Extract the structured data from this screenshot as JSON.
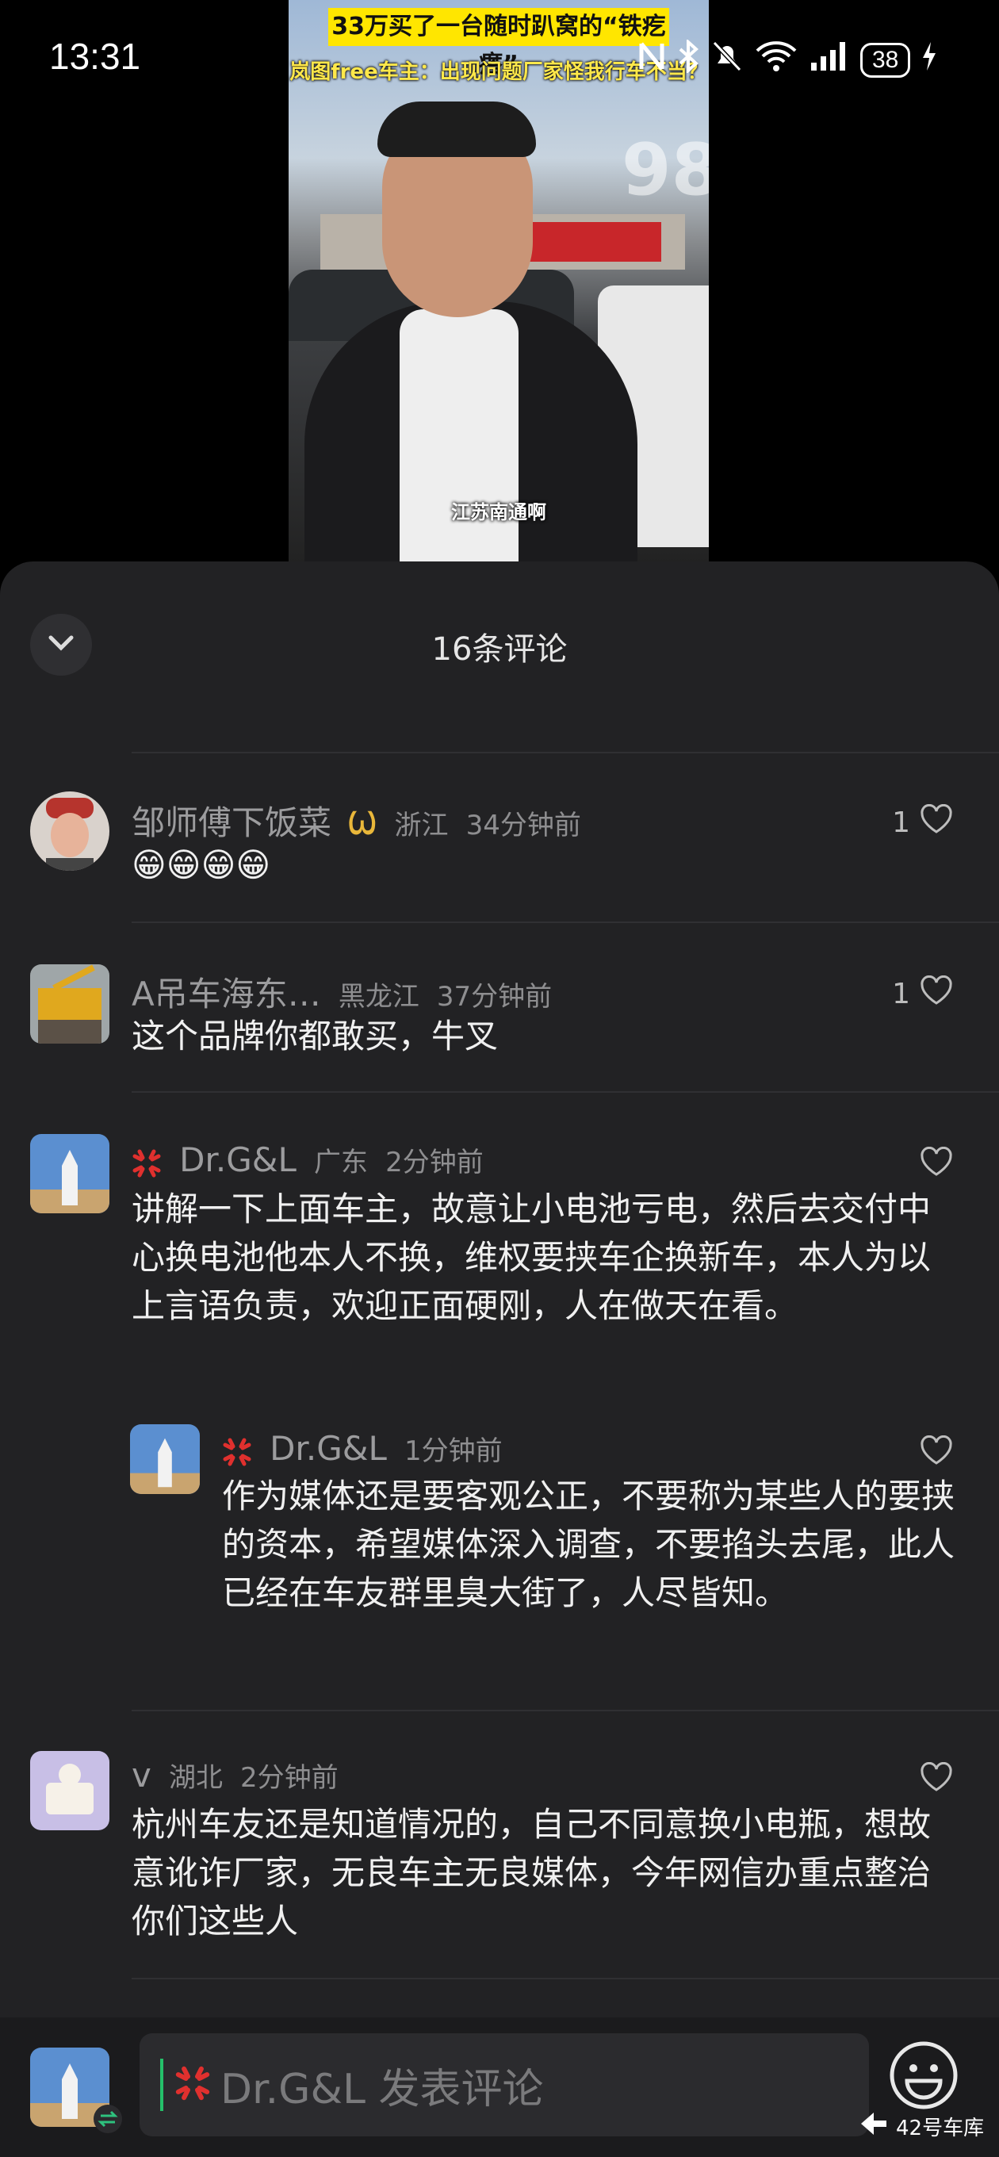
{
  "status_bar": {
    "time": "13:31",
    "battery": "38"
  },
  "video": {
    "title_line1": "33万买了一台随时趴窝的“铁疙瘩”",
    "title_line2": "岚图free车主：出现问题厂家怪我行车不当？",
    "caption": "江苏南通啊",
    "watermark": "98"
  },
  "sheet": {
    "title": "16条评论"
  },
  "comments": [
    {
      "user": "邹师傅下饭菜",
      "region": "浙江",
      "time": "34分钟前",
      "text": "😁😁😁😁",
      "likes": "1"
    },
    {
      "user": "A吊车海东…",
      "region": "黑龙江",
      "time": "37分钟前",
      "text": "这个品牌你都敢买，牛叉",
      "likes": "1"
    },
    {
      "user": "Dr.G&L",
      "region": "广东",
      "time": "2分钟前",
      "text": "讲解一下上面车主，故意让小电池亏电，然后去交付中心换电池他本人不换，维权要挟车企换新车，本人为以上言语负责，欢迎正面硬刚，人在做天在看。",
      "likes": ""
    },
    {
      "user": "v",
      "region": "湖北",
      "time": "2分钟前",
      "text": "杭州车友还是知道情况的，自己不同意换小电瓶，想故意讹诈厂家，无良车主无良媒体，今年网信办重点整治你们这些人",
      "likes": ""
    }
  ],
  "reply": {
    "user": "Dr.G&L",
    "time": "1分钟前",
    "text": "作为媒体还是要客观公正，不要称为某些人的要挟的资本，希望媒体深入调查，不要掐头去尾，此人已经在车友群里臭大街了，人尽皆知。",
    "likes": ""
  },
  "input": {
    "placeholder": "Dr.G&L 发表评论"
  },
  "brand": {
    "label": "42号车库"
  },
  "colors": {
    "sheet_bg": "#222224",
    "accent_red": "#e0302e",
    "cursor_green": "#24c06a"
  }
}
